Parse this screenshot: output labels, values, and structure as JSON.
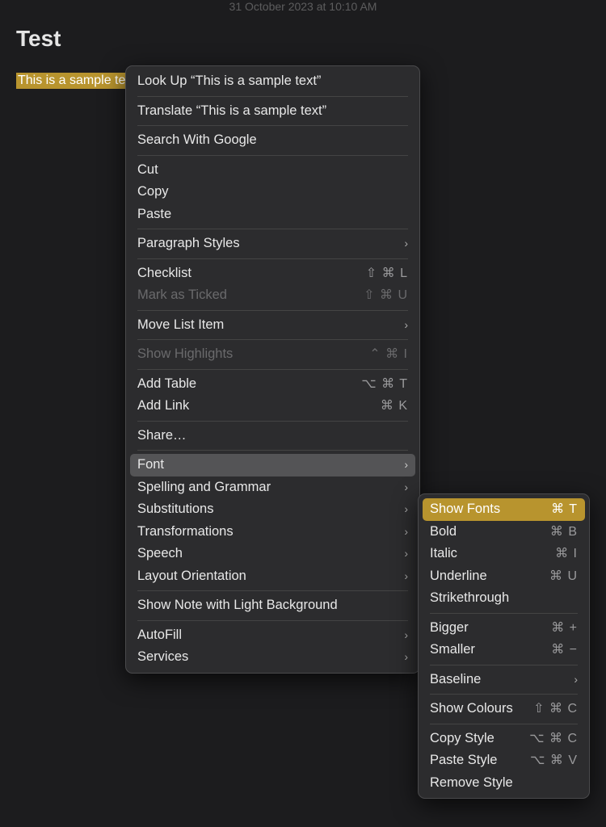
{
  "timestamp": "31 October 2023 at 10:10 AM",
  "title": "Test",
  "selected_text": "This is a sample text",
  "menu": {
    "lookup": "Look Up “This is a sample text”",
    "translate": "Translate “This is a sample text”",
    "search": "Search With Google",
    "cut": "Cut",
    "copy": "Copy",
    "paste": "Paste",
    "paragraph_styles": "Paragraph Styles",
    "checklist": {
      "label": "Checklist",
      "shortcut": "⇧ ⌘ L"
    },
    "mark_ticked": {
      "label": "Mark as Ticked",
      "shortcut": "⇧ ⌘ U"
    },
    "move_list": "Move List Item",
    "show_highlights": {
      "label": "Show Highlights",
      "shortcut": "⌃ ⌘ I"
    },
    "add_table": {
      "label": "Add Table",
      "shortcut": "⌥ ⌘ T"
    },
    "add_link": {
      "label": "Add Link",
      "shortcut": "⌘ K"
    },
    "share": "Share…",
    "font": "Font",
    "spelling": "Spelling and Grammar",
    "substitutions": "Substitutions",
    "transformations": "Transformations",
    "speech": "Speech",
    "layout": "Layout Orientation",
    "light_bg": "Show Note with Light Background",
    "autofill": "AutoFill",
    "services": "Services"
  },
  "submenu": {
    "show_fonts": {
      "label": "Show Fonts",
      "shortcut": "⌘ T"
    },
    "bold": {
      "label": "Bold",
      "shortcut": "⌘ B"
    },
    "italic": {
      "label": "Italic",
      "shortcut": "⌘ I"
    },
    "underline": {
      "label": "Underline",
      "shortcut": "⌘ U"
    },
    "strikethrough": "Strikethrough",
    "bigger": {
      "label": "Bigger",
      "shortcut": "⌘ +"
    },
    "smaller": {
      "label": "Smaller",
      "shortcut": "⌘ −"
    },
    "baseline": "Baseline",
    "show_colours": {
      "label": "Show Colours",
      "shortcut": "⇧ ⌘ C"
    },
    "copy_style": {
      "label": "Copy Style",
      "shortcut": "⌥ ⌘ C"
    },
    "paste_style": {
      "label": "Paste Style",
      "shortcut": "⌥ ⌘ V"
    },
    "remove_style": "Remove Style"
  },
  "chevron": "›"
}
